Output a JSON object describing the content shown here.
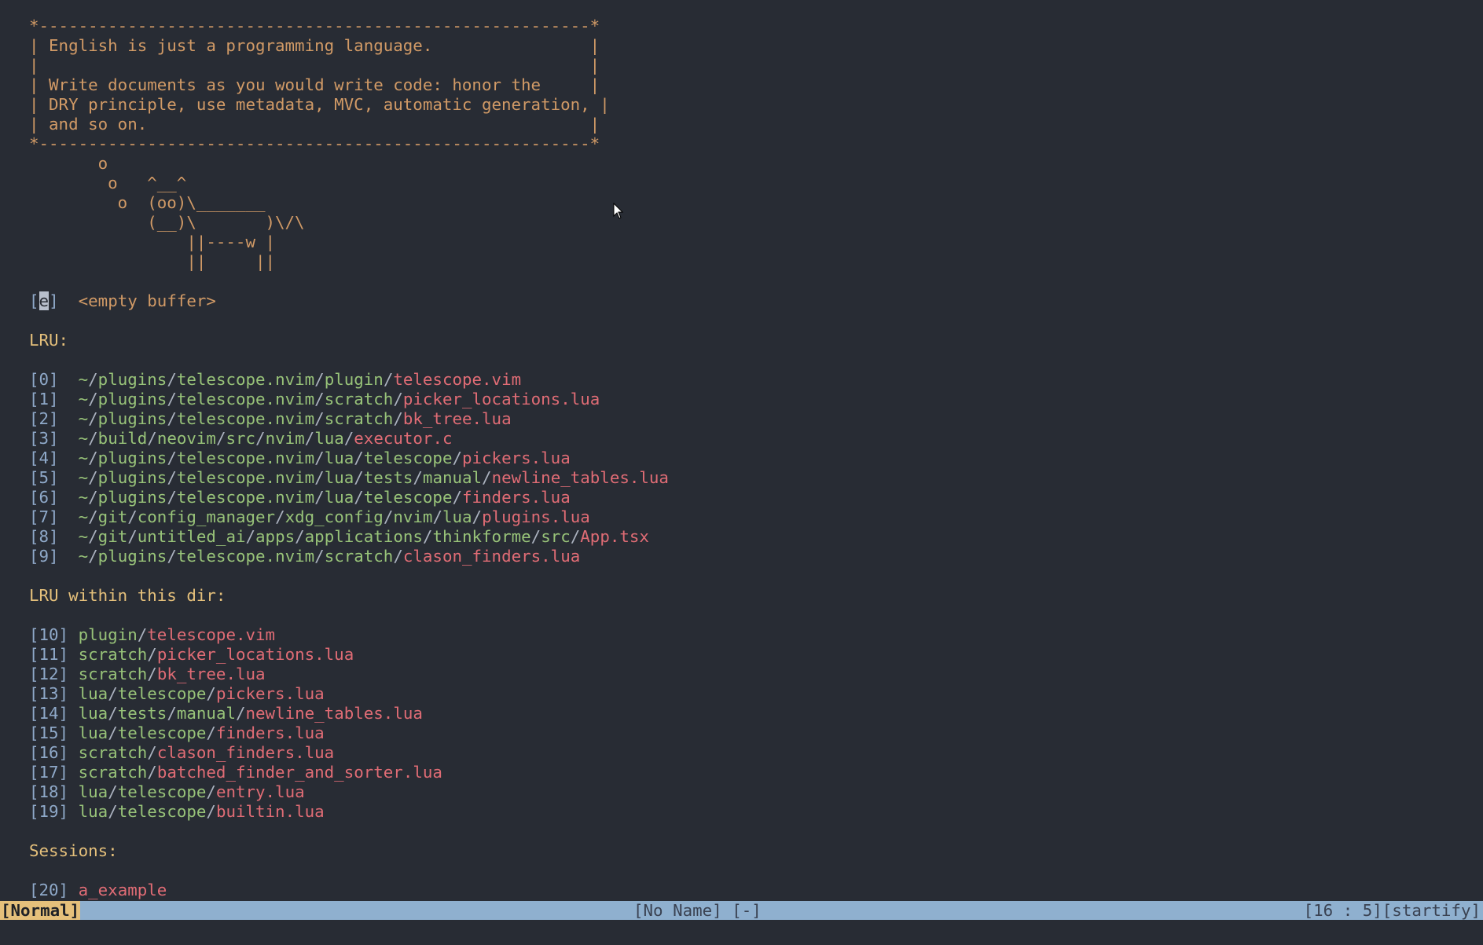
{
  "quote_box": [
    "*--------------------------------------------------------*",
    "| English is just a programming language.                |",
    "|                                                        |",
    "| Write documents as you would write code: honor the     |",
    "| DRY principle, use metadata, MVC, automatic generation, |",
    "| and so on.                                             |",
    "*--------------------------------------------------------*"
  ],
  "cow": [
    "       o",
    "        o   ^__^",
    "         o  (oo)\\_______",
    "            (__)\\       )\\/\\",
    "                ||----w |",
    "                ||     ||"
  ],
  "empty_buffer": {
    "bracket_open": "[",
    "key": "e",
    "bracket_close": "]",
    "label": "  <empty buffer>"
  },
  "sections": {
    "lru_header": "LRU:",
    "lru_dir_header": "LRU within this dir:",
    "sessions_header": "Sessions:"
  },
  "lru": [
    {
      "key": "[0]",
      "dir": "~/plugins/telescope.nvim/plugin/",
      "file": "telescope.vim"
    },
    {
      "key": "[1]",
      "dir": "~/plugins/telescope.nvim/scratch/",
      "file": "picker_locations.lua"
    },
    {
      "key": "[2]",
      "dir": "~/plugins/telescope.nvim/scratch/",
      "file": "bk_tree.lua"
    },
    {
      "key": "[3]",
      "dir": "~/build/neovim/src/nvim/lua/",
      "file": "executor.c"
    },
    {
      "key": "[4]",
      "dir": "~/plugins/telescope.nvim/lua/telescope/",
      "file": "pickers.lua"
    },
    {
      "key": "[5]",
      "dir": "~/plugins/telescope.nvim/lua/tests/manual/",
      "file": "newline_tables.lua"
    },
    {
      "key": "[6]",
      "dir": "~/plugins/telescope.nvim/lua/telescope/",
      "file": "finders.lua"
    },
    {
      "key": "[7]",
      "dir": "~/git/config_manager/xdg_config/nvim/lua/",
      "file": "plugins.lua"
    },
    {
      "key": "[8]",
      "dir": "~/git/untitled_ai/apps/applications/thinkforme/src/",
      "file": "App.tsx"
    },
    {
      "key": "[9]",
      "dir": "~/plugins/telescope.nvim/scratch/",
      "file": "clason_finders.lua"
    }
  ],
  "lru_dir": [
    {
      "key": "[10]",
      "dir": "plugin/",
      "file": "telescope.vim"
    },
    {
      "key": "[11]",
      "dir": "scratch/",
      "file": "picker_locations.lua"
    },
    {
      "key": "[12]",
      "dir": "scratch/",
      "file": "bk_tree.lua"
    },
    {
      "key": "[13]",
      "dir": "lua/telescope/",
      "file": "pickers.lua"
    },
    {
      "key": "[14]",
      "dir": "lua/tests/manual/",
      "file": "newline_tables.lua"
    },
    {
      "key": "[15]",
      "dir": "lua/telescope/",
      "file": "finders.lua"
    },
    {
      "key": "[16]",
      "dir": "scratch/",
      "file": "clason_finders.lua"
    },
    {
      "key": "[17]",
      "dir": "scratch/",
      "file": "batched_finder_and_sorter.lua"
    },
    {
      "key": "[18]",
      "dir": "lua/telescope/",
      "file": "entry.lua"
    },
    {
      "key": "[19]",
      "dir": "lua/telescope/",
      "file": "builtin.lua"
    }
  ],
  "sessions": [
    {
      "key": "[20]",
      "name": "a_example"
    }
  ],
  "statusline": {
    "mode": "[Normal]",
    "filename": "[No Name] [-]",
    "position": "[16 : 5][startify]"
  },
  "colors": {
    "background": "#282c34",
    "statusline": "#8fb0cf",
    "mode": "#e5c07b",
    "quote": "#d19a66",
    "dir": "#98c379",
    "file": "#e06c75",
    "header": "#e5c07b"
  },
  "icons": {
    "mouse": "mouse-pointer-icon"
  }
}
